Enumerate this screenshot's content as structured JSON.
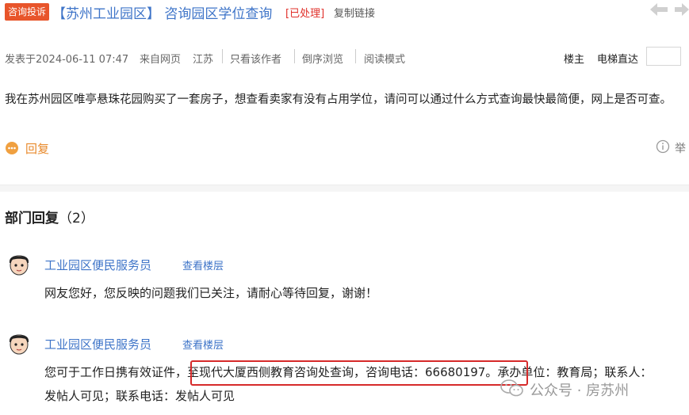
{
  "header": {
    "badge": "咨询投诉",
    "title": "【苏州工业园区】 咨询园区学位查询",
    "status": "[已处理]",
    "copy_link": "复制链接"
  },
  "meta": {
    "posted": "发表于2024-06-11 07:47",
    "from": "来自网页",
    "region": "江苏",
    "only_author": "只看该作者",
    "reverse": "倒序浏览",
    "reading_mode": "阅读模式",
    "floor_owner": "楼主",
    "elevator": "电梯直达"
  },
  "post": {
    "text": "我在苏州园区唯亭悬珠花园购买了一套房子，想查看卖家有没有占用学位，请问可以通过什么方式查询最快最简便，网上是否可查。",
    "reply": "回复",
    "report": "举"
  },
  "dept": {
    "label": "部门回复",
    "count": "（2）"
  },
  "replies": [
    {
      "author": "工业园区便民服务员",
      "view_floor": "查看楼层",
      "text_line1": "网友您好，您反映的问题我们已关注，请耐心等待回复，谢谢！"
    },
    {
      "author": "工业园区便民服务员",
      "view_floor": "查看楼层",
      "text_line1": "您可于工作日携有效证件，至现代大厦西侧教育咨询处查询，咨询电话：66680197。承办单位：教育局；联系人：",
      "text_line2": "发帖人可见；联系电话：发帖人可见"
    }
  ],
  "watermark": "公众号 · 房苏州",
  "colors": {
    "accent": "#3e74c8",
    "badge": "#e8552b",
    "status": "#e0302a",
    "highlight_box": "#d62a2a",
    "reply_orange": "#e88a2c"
  }
}
